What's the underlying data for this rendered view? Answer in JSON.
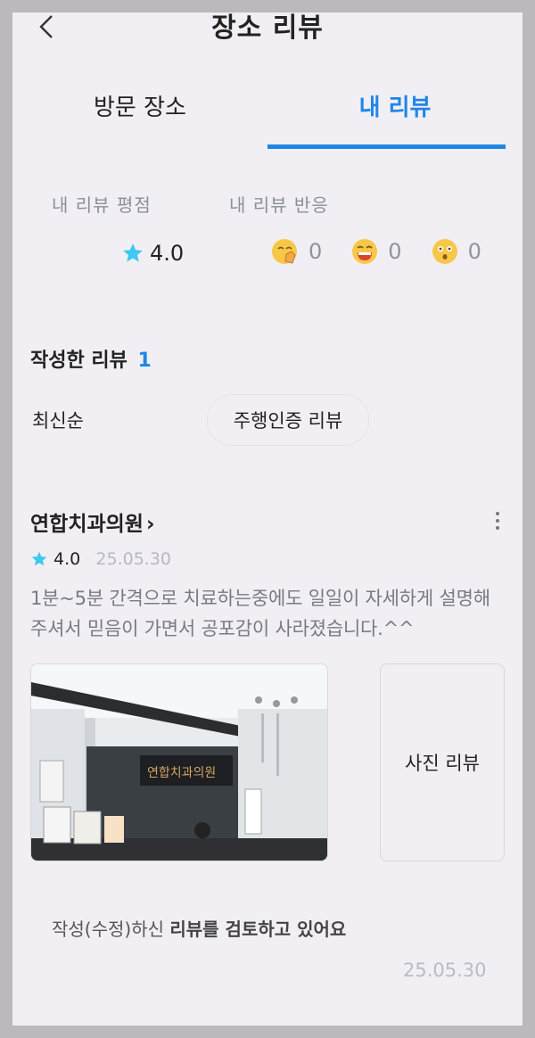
{
  "header": {
    "title": "장소 리뷰"
  },
  "tabs": {
    "visited": "방문 장소",
    "my_reviews": "내 리뷰"
  },
  "stats": {
    "rating_label": "내 리뷰 평점",
    "rating_value": "4.0",
    "reaction_label": "내 리뷰 반응",
    "reactions": [
      {
        "icon": "clap-emoji-icon",
        "count": "0"
      },
      {
        "icon": "laugh-emoji-icon",
        "count": "0"
      },
      {
        "icon": "wow-emoji-icon",
        "count": "0"
      }
    ]
  },
  "written": {
    "label": "작성한 리뷰",
    "count": "1"
  },
  "filters": {
    "sort": "최신순",
    "drive_verified": "주행인증 리뷰",
    "photo": "사진 리뷰"
  },
  "review": {
    "place_name": "연합치과의원",
    "chevron": "›",
    "score": "4.0",
    "separator": "·",
    "date": "25.05.30",
    "text": "1분~5분 간격으로 치료하는중에도 일일이 자세하게 설명해 주셔서 믿음이 가면서 공포감이 사라졌습니다.^^",
    "photo_sign_text": "연합치과의원",
    "status_prefix": "작성(수정)하신 ",
    "status_bold": "리뷰를 검토하고 있어요",
    "footer_date": "25.05.30"
  },
  "colors": {
    "accent": "#1f86e8",
    "star": "#3cc8f0",
    "emoji": "#f7c848"
  }
}
